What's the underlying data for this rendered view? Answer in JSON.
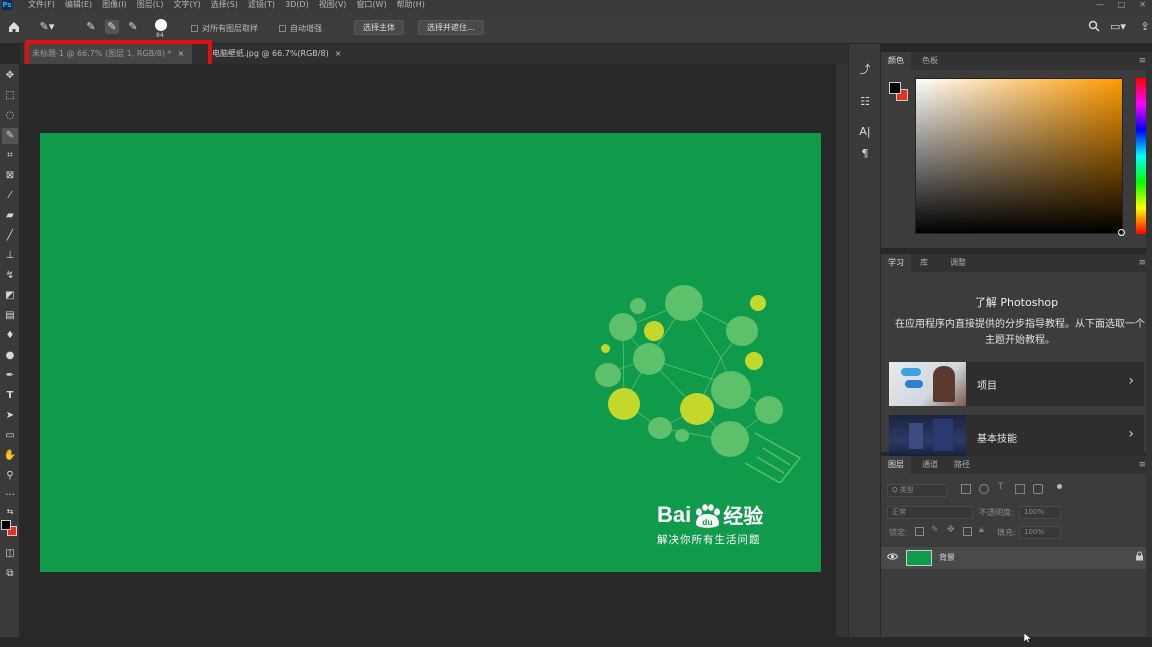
{
  "app": {
    "logo_text": "Ps"
  },
  "menu": {
    "items": [
      "文件(F)",
      "编辑(E)",
      "图像(I)",
      "图层(L)",
      "文字(Y)",
      "选择(S)",
      "滤镜(T)",
      "3D(D)",
      "视图(V)",
      "窗口(W)",
      "帮助(H)"
    ],
    "window_controls": [
      "—",
      "□",
      "✕"
    ]
  },
  "options_bar": {
    "brush_size": "84",
    "sample_all_layers": "对所有图层取样",
    "auto_enhance": "自动增强",
    "select_subject": "选择主体",
    "select_and_mask": "选择并遮住..."
  },
  "documents": {
    "tabs": [
      {
        "label": "未标题-1 @ 66.7% (图层 1, RGB/8) *",
        "active": true
      },
      {
        "label": "电脑壁纸.jpg @ 66.7%(RGB/8)",
        "active": false
      }
    ],
    "close_glyph": "×"
  },
  "artwork": {
    "background_color": "#0f9a4c",
    "brand_left": "Bai",
    "brand_mid": "du",
    "brand_right": "经验",
    "tagline": "解决你所有生活问题"
  },
  "panels": {
    "color": {
      "tabs": [
        "颜色",
        "色板"
      ],
      "foreground": "#000000",
      "background": "#e6321e"
    },
    "learn": {
      "tabs": [
        "学习",
        "库",
        "调整"
      ],
      "title": "了解 Photoshop",
      "description": "在应用程序内直接提供的分步指导教程。从下面选取一个主题开始教程。",
      "cards": [
        {
          "label": "项目",
          "chevron": "›"
        },
        {
          "label": "基本技能",
          "chevron": "›"
        }
      ]
    },
    "layers": {
      "tabs": [
        "图层",
        "通道",
        "路径"
      ],
      "filter_kind": "Q 类型",
      "blend_mode": "正常",
      "opacity_label": "不透明度:",
      "opacity_value": "100%",
      "lock_label": "锁定:",
      "fill_label": "填充:",
      "fill_value": "100%",
      "layer_name": "背景"
    }
  }
}
